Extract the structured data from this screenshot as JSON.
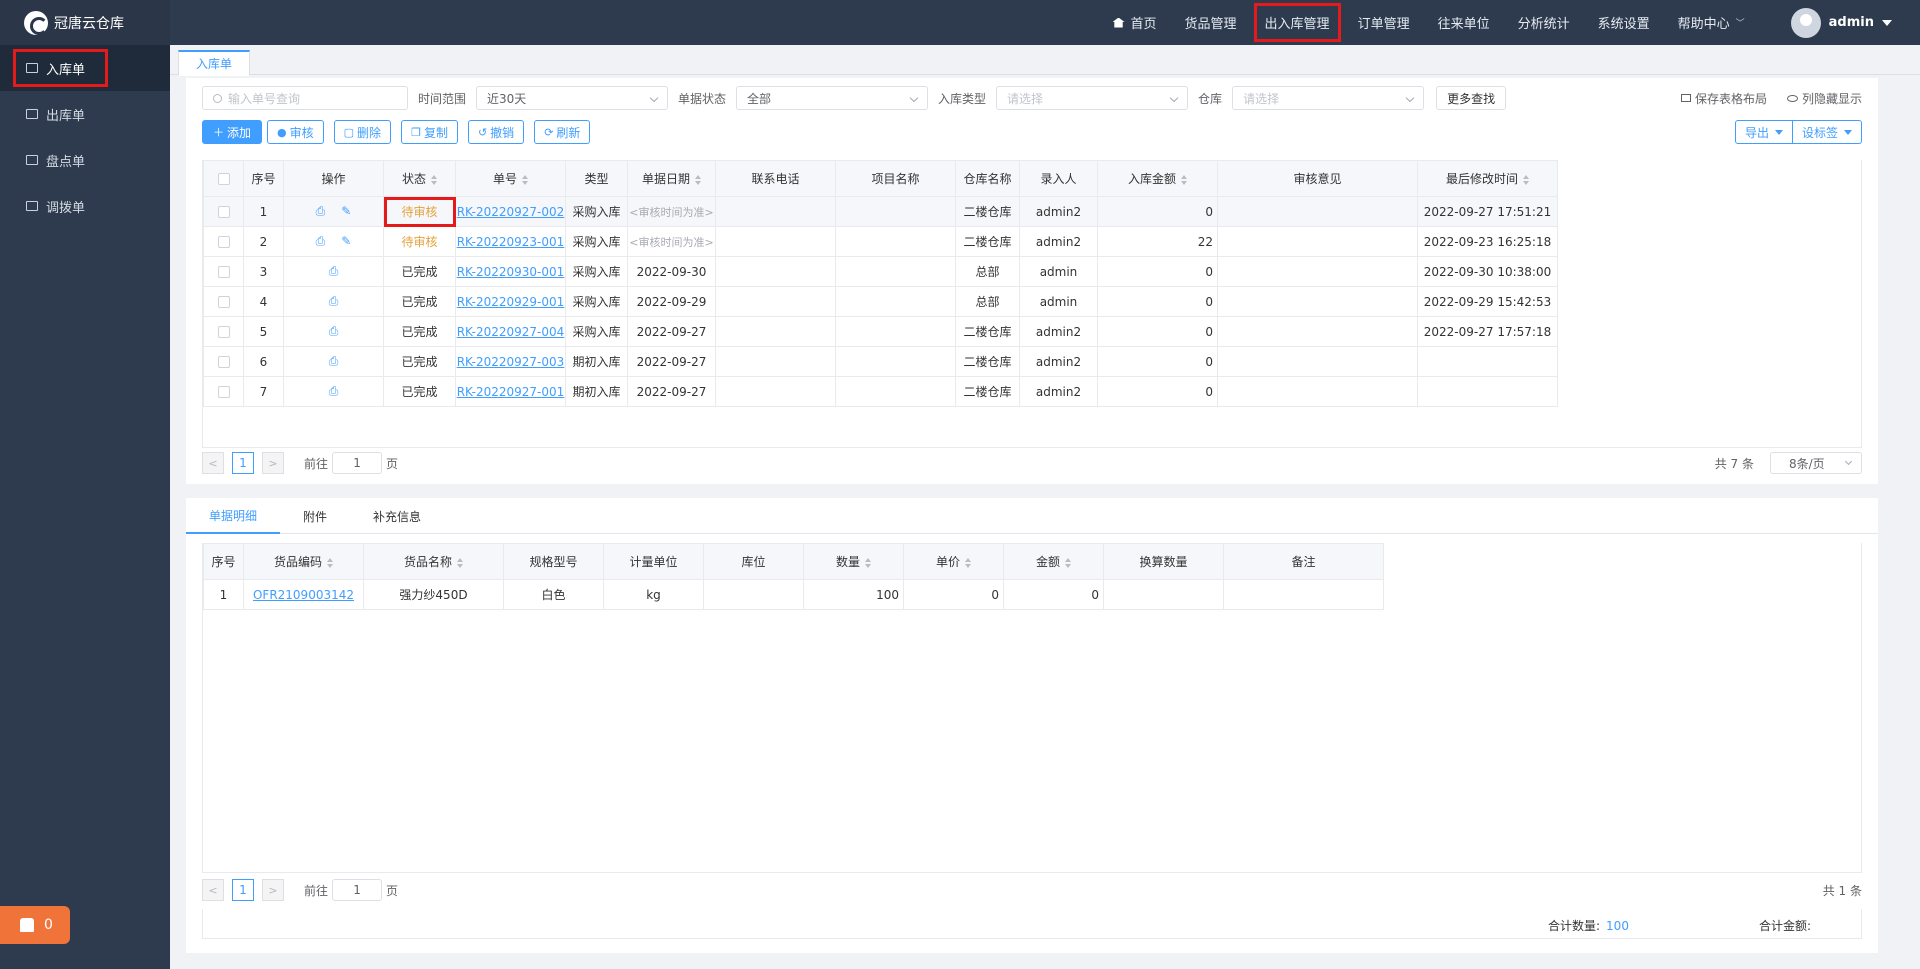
{
  "app": {
    "name": "冠唐云仓库"
  },
  "sidebar": {
    "items": [
      {
        "label": "入库单"
      },
      {
        "label": "出库单"
      },
      {
        "label": "盘点单"
      },
      {
        "label": "调拨单"
      }
    ]
  },
  "alarm": {
    "count": "0"
  },
  "topnav": {
    "items": [
      "首页",
      "货品管理",
      "出入库管理",
      "订单管理",
      "往来单位",
      "分析统计",
      "系统设置",
      "帮助中心"
    ],
    "active": "出入库管理",
    "user": "admin"
  },
  "tabstrip": {
    "active": "入库单"
  },
  "filters": {
    "search_placeholder": "输入单号查询",
    "range_label": "时间范围",
    "range_value": "近30天",
    "status_label": "单据状态",
    "status_value": "全部",
    "type_label": "入库类型",
    "type_placeholder": "请选择",
    "wh_label": "仓库",
    "wh_placeholder": "请选择",
    "more": "更多查找",
    "save_layout": "保存表格布局",
    "toggle_cols": "列隐藏显示"
  },
  "toolbar": {
    "add": "添加",
    "audit": "审核",
    "delete": "删除",
    "copy": "复制",
    "revoke": "撤销",
    "refresh": "刷新",
    "export": "导出",
    "label": "设标签"
  },
  "main_table": {
    "headers": [
      "序号",
      "操作",
      "状态",
      "单号",
      "类型",
      "单据日期",
      "联系电话",
      "项目名称",
      "仓库名称",
      "录入人",
      "入库金额",
      "审核意见",
      "最后修改时间"
    ],
    "rows": [
      {
        "idx": "1",
        "status": "待审核",
        "no": "RK-20220927-002",
        "type": "采购入库",
        "date": "<审核时间为准>",
        "phone": "",
        "project": "",
        "wh": "二楼仓库",
        "user": "admin2",
        "amount": "0",
        "opinion": "",
        "modified": "2022-09-27 17:51:21"
      },
      {
        "idx": "2",
        "status": "待审核",
        "no": "RK-20220923-001",
        "type": "采购入库",
        "date": "<审核时间为准>",
        "phone": "",
        "project": "",
        "wh": "二楼仓库",
        "user": "admin2",
        "amount": "22",
        "opinion": "",
        "modified": "2022-09-23 16:25:18"
      },
      {
        "idx": "3",
        "status": "已完成",
        "no": "RK-20220930-001",
        "type": "采购入库",
        "date": "2022-09-30",
        "phone": "",
        "project": "",
        "wh": "总部",
        "user": "admin",
        "amount": "0",
        "opinion": "",
        "modified": "2022-09-30 10:38:00"
      },
      {
        "idx": "4",
        "status": "已完成",
        "no": "RK-20220929-001",
        "type": "采购入库",
        "date": "2022-09-29",
        "phone": "",
        "project": "",
        "wh": "总部",
        "user": "admin",
        "amount": "0",
        "opinion": "",
        "modified": "2022-09-29 15:42:53"
      },
      {
        "idx": "5",
        "status": "已完成",
        "no": "RK-20220927-004",
        "type": "采购入库",
        "date": "2022-09-27",
        "phone": "",
        "project": "",
        "wh": "二楼仓库",
        "user": "admin2",
        "amount": "0",
        "opinion": "",
        "modified": "2022-09-27 17:57:18"
      },
      {
        "idx": "6",
        "status": "已完成",
        "no": "RK-20220927-003",
        "type": "期初入库",
        "date": "2022-09-27",
        "phone": "",
        "project": "",
        "wh": "二楼仓库",
        "user": "admin2",
        "amount": "0",
        "opinion": "",
        "modified": ""
      },
      {
        "idx": "7",
        "status": "已完成",
        "no": "RK-20220927-001",
        "type": "期初入库",
        "date": "2022-09-27",
        "phone": "",
        "project": "",
        "wh": "二楼仓库",
        "user": "admin2",
        "amount": "0",
        "opinion": "",
        "modified": ""
      }
    ]
  },
  "pager": {
    "page": "1",
    "goto_prefix": "前往",
    "goto_suffix": "页",
    "total": "共 7 条",
    "size": "8条/页"
  },
  "detail_tabs": [
    "单据明细",
    "附件",
    "补充信息"
  ],
  "detail_table": {
    "headers": [
      "序号",
      "货品编码",
      "货品名称",
      "规格型号",
      "计量单位",
      "库位",
      "数量",
      "单价",
      "金额",
      "换算数量",
      "备注"
    ],
    "rows": [
      {
        "idx": "1",
        "code": "OFR2109003142",
        "name": "强力纱450D",
        "spec": "白色",
        "unit": "kg",
        "loc": "",
        "qty": "100",
        "price": "0",
        "amount": "0",
        "conv": "",
        "note": ""
      }
    ]
  },
  "detail_pager": {
    "page": "1",
    "goto_prefix": "前往",
    "goto_suffix": "页",
    "total": "共 1 条"
  },
  "summary": {
    "qty_label": "合计数量:",
    "qty": "100",
    "amount_label": "合计金额:"
  }
}
